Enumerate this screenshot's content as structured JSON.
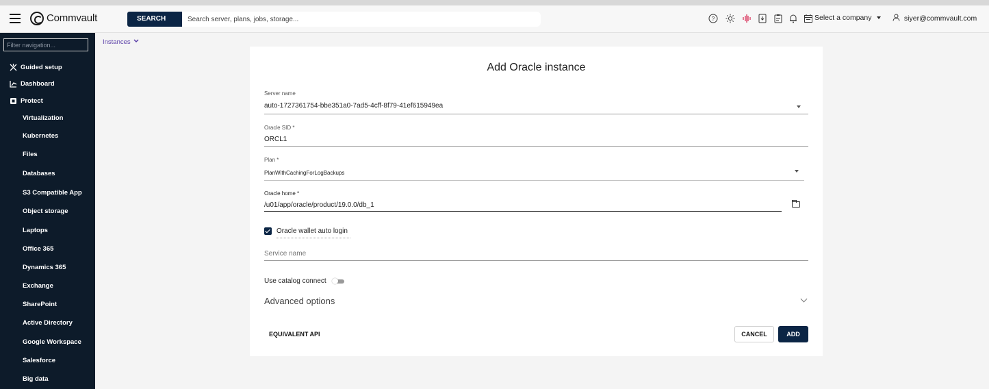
{
  "header": {
    "brand": "Commvault",
    "search_label": "SEARCH",
    "search_placeholder": "Search server, plans, jobs, storage...",
    "icons": [
      "help-icon",
      "theme-icon",
      "activity-icon",
      "download-icon",
      "clipboard-icon",
      "bell-icon",
      "calendar-icon"
    ],
    "company_select": "Select a company",
    "user": "siyer@commvault.com"
  },
  "sidebar": {
    "filter_placeholder": "Filter navigation...",
    "top_items": [
      {
        "label": "Guided setup",
        "icon": "guided-setup-icon"
      },
      {
        "label": "Dashboard",
        "icon": "dashboard-icon"
      },
      {
        "label": "Protect",
        "icon": "protect-icon"
      }
    ],
    "items": [
      "Virtualization",
      "Kubernetes",
      "Files",
      "Databases",
      "S3 Compatible App",
      "Object storage",
      "Laptops",
      "Office 365",
      "Dynamics 365",
      "Exchange",
      "SharePoint",
      "Active Directory",
      "Google Workspace",
      "Salesforce",
      "Big data"
    ]
  },
  "breadcrumb": "Instances",
  "form": {
    "title": "Add Oracle instance",
    "server_name": {
      "label": "Server name",
      "value": "auto-1727361754-bbe351a0-7ad5-4cff-8f79-41ef615949ea"
    },
    "oracle_sid": {
      "label": "Oracle SID *",
      "value": "ORCL1"
    },
    "plan": {
      "label": "Plan *",
      "value": "PlanWithCachingForLogBackups"
    },
    "oracle_home": {
      "label": "Oracle home *",
      "value": "/u01/app/oracle/product/19.0.0/db_1"
    },
    "wallet_auto_login": {
      "label": "Oracle wallet auto login",
      "checked": true
    },
    "service_name": {
      "placeholder": "Service name"
    },
    "catalog_connect": {
      "label": "Use catalog connect",
      "enabled": false
    },
    "advanced_options": "Advanced options",
    "equivalent_api": "EQUIVALENT API",
    "cancel": "CANCEL",
    "add": "ADD"
  }
}
